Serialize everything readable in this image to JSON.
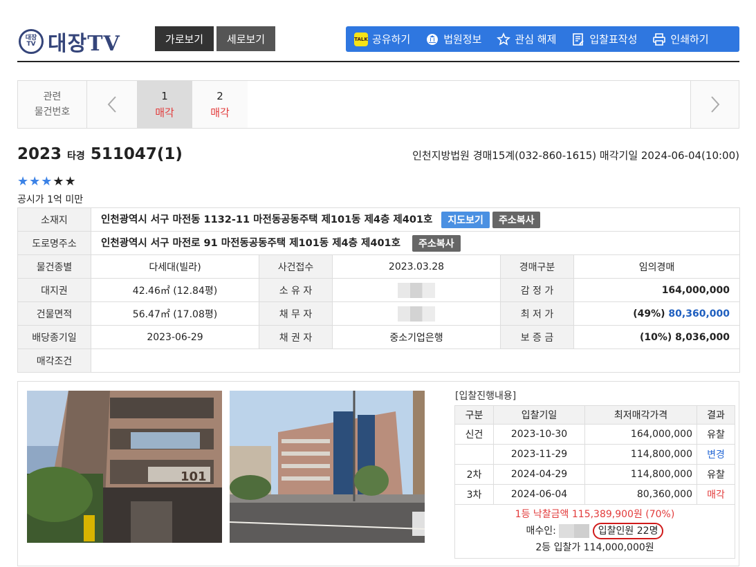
{
  "header": {
    "logo_mark_top": "대장",
    "logo_mark_bottom": "TV",
    "logo_text": "대장TV",
    "view_horizontal": "가로보기",
    "view_vertical": "세로보기",
    "toolbar": {
      "share": "공유하기",
      "kakao_icon_text": "TALK",
      "court_info": "법원정보",
      "unfavorite": "관심 해제",
      "bid_form": "입찰표작성",
      "print": "인쇄하기"
    }
  },
  "related": {
    "label_line1": "관련",
    "label_line2": "물건번호",
    "items": [
      {
        "no": "1",
        "status": "매각"
      },
      {
        "no": "2",
        "status": "매각"
      }
    ]
  },
  "case": {
    "year": "2023",
    "type": "타경",
    "number": "511047(1)",
    "court_line": "인천지방법원 경매15계(032-860-1615) 매각기일 2024-06-04(10:00)",
    "stars_on": "★★★",
    "stars_off": "★★",
    "price_note": "공시가 1억 미만"
  },
  "info": {
    "location_label": "소재지",
    "location": "인천광역시 서구 마전동 1132-11 마전동공동주택 제101동 제4층 제401호",
    "map_button": "지도보기",
    "copy_button": "주소복사",
    "road_label": "도로명주소",
    "road": "인천광역시 서구 마전로 91 마전동공동주택 제101동 제4층 제401호",
    "copy_button2": "주소복사",
    "rows": {
      "kind_label": "물건종별",
      "kind": "다세대(빌라)",
      "filed_label": "사건접수",
      "filed": "2023.03.28",
      "auction_type_label": "경매구분",
      "auction_type": "임의경매",
      "land_label": "대지권",
      "land": "42.46㎡ (12.84평)",
      "owner_label": "소 유 자",
      "appraisal_label": "감 정 가",
      "appraisal": "164,000,000",
      "building_label": "건물면적",
      "building": "56.47㎡ (17.08평)",
      "debtor_label": "채 무 자",
      "min_label": "최 저 가",
      "min_pct": "(49%)",
      "min_value": "80,360,000",
      "dividend_label": "배당종기일",
      "dividend": "2023-06-29",
      "creditor_label": "채 권 자",
      "creditor": "중소기업은행",
      "deposit_label": "보 증 금",
      "deposit": "(10%) 8,036,000",
      "conditions_label": "매각조건"
    }
  },
  "bids": {
    "title": "[입찰진행내용]",
    "headers": [
      "구분",
      "입찰기일",
      "최저매각가격",
      "결과"
    ],
    "rows": [
      {
        "round": "신건",
        "date": "2023-10-30",
        "price": "164,000,000",
        "result": "유찰"
      },
      {
        "round": "",
        "date": "2023-11-29",
        "price": "114,800,000",
        "result": "변경"
      },
      {
        "round": "2차",
        "date": "2024-04-29",
        "price": "114,800,000",
        "result": "유찰"
      },
      {
        "round": "3차",
        "date": "2024-06-04",
        "price": "80,360,000",
        "result": "매각"
      }
    ],
    "winner_line": "1등 낙찰금액 115,389,900원 (70%)",
    "buyer_label": "매수인:",
    "bidders": "입찰인원 22명",
    "second_line": "2등 입찰가 114,000,000원"
  },
  "colors": {
    "toolbar_blue": "#2f77e0",
    "accent_red": "#e23a3a",
    "star_blue": "#3b82e6",
    "logo_navy": "#35457a"
  }
}
